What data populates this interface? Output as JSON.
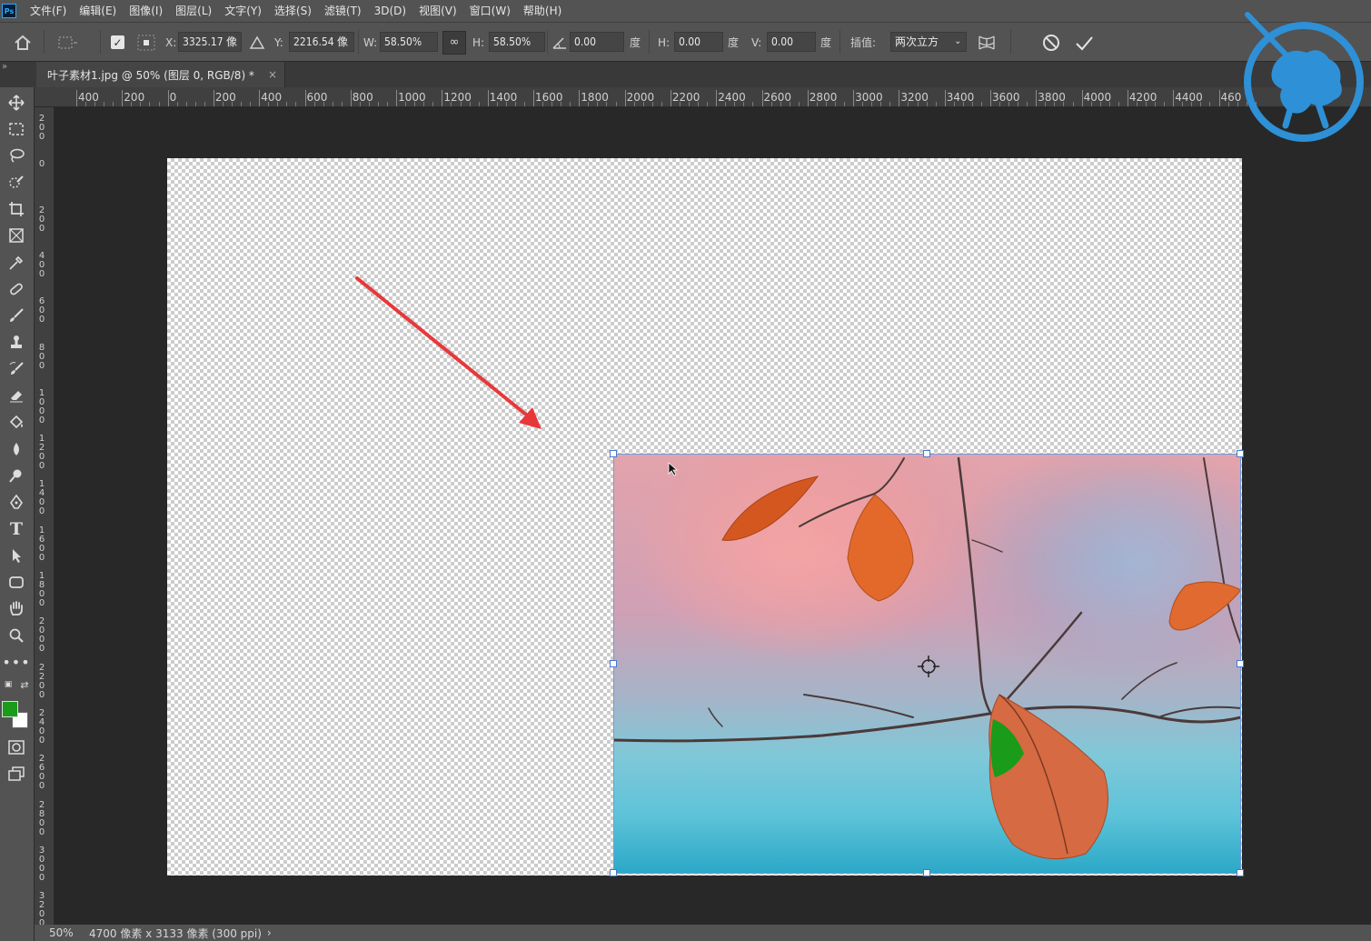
{
  "app": {
    "logo_text": "Ps"
  },
  "menu": [
    "文件(F)",
    "编辑(E)",
    "图像(I)",
    "图层(L)",
    "文字(Y)",
    "选择(S)",
    "滤镜(T)",
    "3D(D)",
    "视图(V)",
    "窗口(W)",
    "帮助(H)"
  ],
  "options": {
    "x_label": "X:",
    "x_value": "3325.17 像",
    "y_label": "Y:",
    "y_value": "2216.54 像",
    "w_label": "W:",
    "w_value": "58.50%",
    "h_label": "H:",
    "h_value": "58.50%",
    "angle_value": "0.00",
    "angle_unit": "度",
    "hskew_label": "H:",
    "hskew_value": "0.00",
    "hskew_unit": "度",
    "vskew_label": "V:",
    "vskew_value": "0.00",
    "vskew_unit": "度",
    "interp_label": "插值:",
    "interp_value": "两次立方"
  },
  "tab": {
    "title": "叶子素材1.jpg @ 50% (图层 0, RGB/8) *",
    "close": "×",
    "collapse": "»"
  },
  "ruler_top": [
    "400",
    "200",
    "0",
    "200",
    "400",
    "600",
    "800",
    "1000",
    "1200",
    "1400",
    "1600",
    "1800",
    "2000",
    "2200",
    "2400",
    "2600",
    "2800",
    "3000",
    "3200",
    "3400",
    "3600",
    "3800",
    "4000",
    "4200",
    "4400",
    "460"
  ],
  "ruler_left": [
    "200",
    "0",
    "200",
    "400",
    "600",
    "800",
    "1000",
    "1200",
    "1400",
    "1600",
    "1800",
    "2000",
    "2200",
    "2400",
    "2600",
    "2800",
    "3000",
    "3200"
  ],
  "status": {
    "zoom": "50%",
    "doc_info": "4700 像素 x 3133 像素 (300 ppi)",
    "arrow": "›"
  },
  "colors": {
    "foreground": "#1a9b1a",
    "background": "#ffffff",
    "arrow": "#e8373a"
  }
}
